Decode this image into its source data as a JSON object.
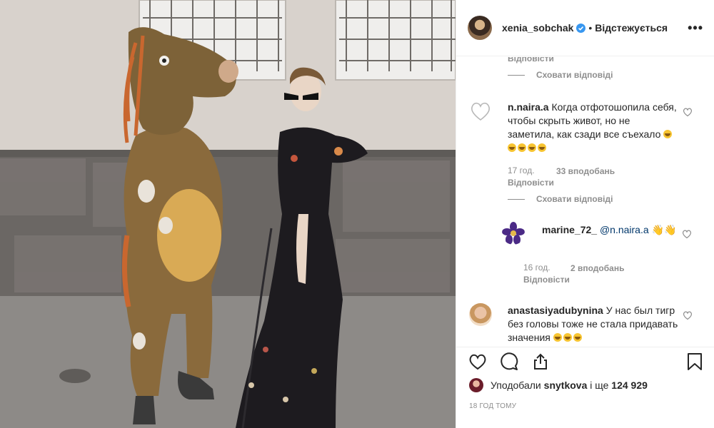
{
  "header": {
    "username": "xenia_sobchak",
    "follow_label": "Відстежується",
    "separator": "•",
    "more_label": "•••"
  },
  "comments": {
    "top_reply_link": "Відповісти",
    "hide_replies_1": "Сховати відповіді",
    "hide_replies_2": "Сховати відповіді",
    "items": [
      {
        "username": "n.naira.a",
        "text": "Когда отфотошопила себя, чтобы скрыть живот, но не заметила, как сзади все съехало",
        "time": "17 год.",
        "likes": "33 вподобань",
        "reply": "Відповісти"
      },
      {
        "username": "marine_72_",
        "mention": "@n.naira.a",
        "text": "👋👋",
        "time": "16 год.",
        "likes": "2 вподобань",
        "reply": "Відповісти"
      },
      {
        "username": "anastasiyadubynina",
        "text": "У нас был тигр без головы тоже не стала придавать значения"
      }
    ]
  },
  "actions": {
    "liked_by_prefix": "Уподобали",
    "liked_by_user": "snytkova",
    "liked_by_middle": "і ще",
    "liked_by_count": "124 929",
    "post_time": "18 ГОД ТОМУ"
  },
  "icons": {
    "like": "heart-icon",
    "comment": "comment-icon",
    "share": "share-icon",
    "save": "bookmark-icon",
    "verified": "verified-badge-icon"
  },
  "colors": {
    "verified_blue": "#3897f0",
    "muted": "#8e8e8e",
    "text": "#262626",
    "mention": "#00376b"
  }
}
